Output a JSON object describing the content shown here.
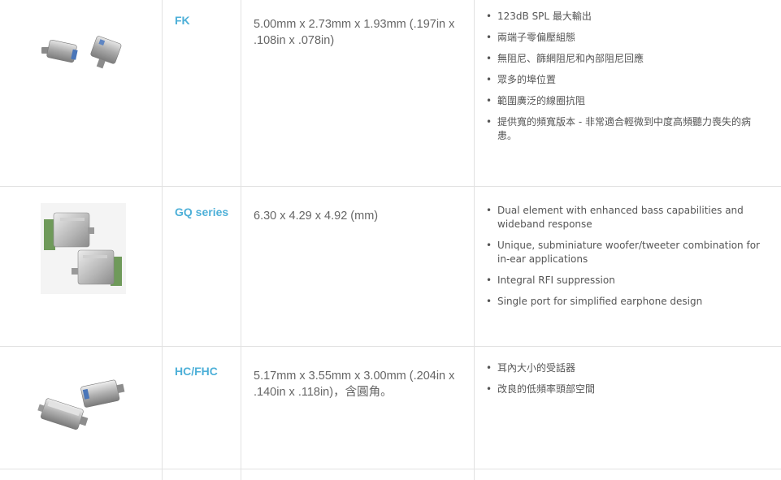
{
  "rows": [
    {
      "model": "FK",
      "dimensions": "5.00mm x 2.73mm x 1.93mm (.197in x .108in x .078in)",
      "features": [
        "123dB SPL 最大輸出",
        "兩端子零偏壓組態",
        "無阻尼、篩網阻尼和內部阻尼回應",
        "眾多的埠位置",
        "範圍廣泛的線圈抗阻",
        "提供寬的頻寬版本 - 非常適合輕微到中度高頻聽力喪失的病患。"
      ]
    },
    {
      "model": "GQ series",
      "dimensions": "6.30 x 4.29 x 4.92 (mm)",
      "features": [
        "Dual element with enhanced bass capabilities and wideband response",
        " Unique, subminiature woofer/tweeter combination for in-ear applications",
        "Integral RFI suppression",
        "Single port for simplified earphone design"
      ]
    },
    {
      "model": "HC/FHC",
      "dimensions": "5.17mm x 3.55mm x 3.00mm (.204in x .140in x .118in)，含圓角。",
      "features": [
        "耳內大小的受話器",
        "改良的低頻率頭部空間"
      ]
    }
  ],
  "bullet": "•",
  "colors": {
    "model_text": "#4eb0d8",
    "border": "#e2e2e2",
    "body_text": "#555555"
  }
}
